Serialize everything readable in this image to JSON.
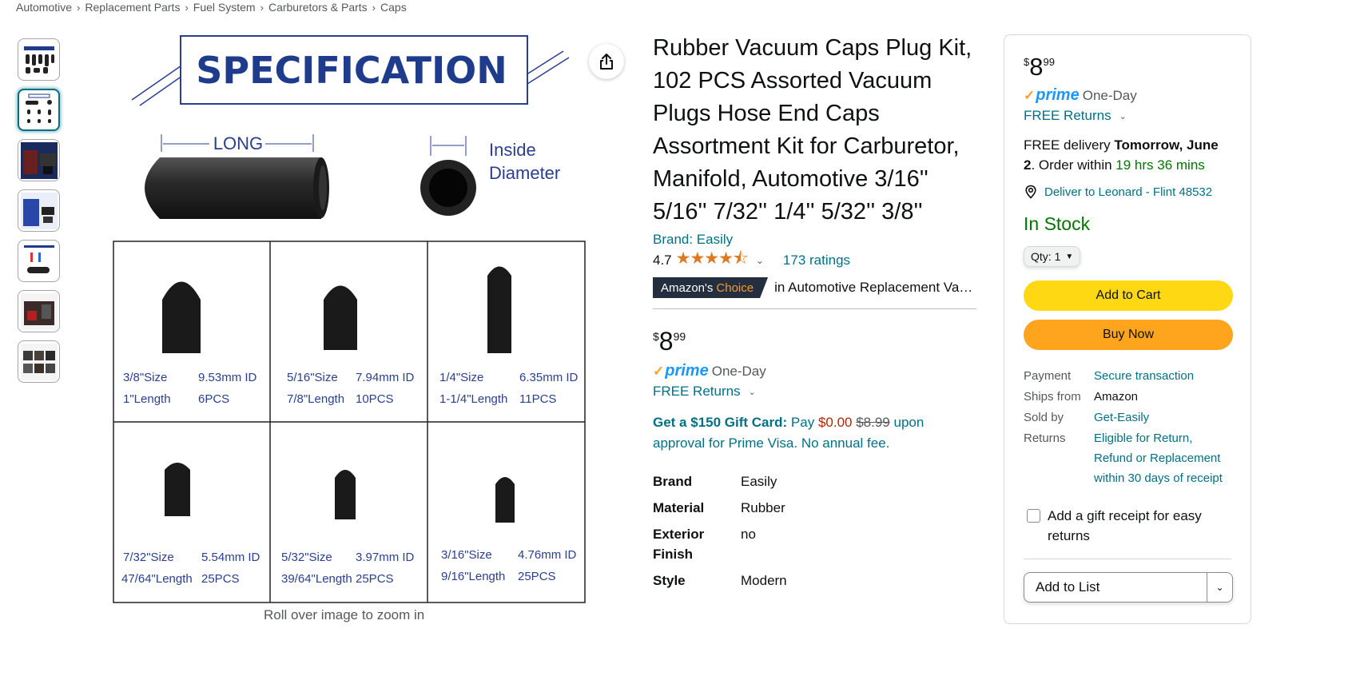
{
  "breadcrumb": [
    "Automotive",
    "Replacement Parts",
    "Fuel System",
    "Carburetors & Parts",
    "Caps"
  ],
  "breadcrumb_sep": "›",
  "image": {
    "spec_title": "SPECIFICATION",
    "long_label": "LONG",
    "inside_label_1": "Inside",
    "inside_label_2": "Diameter",
    "cells": [
      {
        "size": "3/8\"Size",
        "id": "9.53mm ID",
        "length": "1\"Length",
        "pcs": "6PCS"
      },
      {
        "size": "5/16\"Size",
        "id": "7.94mm ID",
        "length": "7/8\"Length",
        "pcs": "10PCS"
      },
      {
        "size": "1/4\"Size",
        "id": "6.35mm ID",
        "length": "1-1/4\"Length",
        "pcs": "11PCS"
      },
      {
        "size": "7/32\"Size",
        "id": "5.54mm ID",
        "length": "47/64\"Length",
        "pcs": "25PCS"
      },
      {
        "size": "5/32\"Size",
        "id": "3.97mm ID",
        "length": "39/64\"Length",
        "pcs": "25PCS"
      },
      {
        "size": "3/16\"Size",
        "id": "4.76mm ID",
        "length": "9/16\"Length",
        "pcs": "25PCS"
      }
    ],
    "zoom_hint": "Roll over image to zoom in"
  },
  "product": {
    "title": "Rubber Vacuum Caps Plug Kit, 102 PCS Assorted Vacuum Plugs Hose End Caps Assortment Kit for Carburetor, Manifold, Automotive 3/16'' 5/16'' 7/32'' 1/4'' 5/32'' 3/8''",
    "brand_link": "Brand: Easily",
    "rating": "4.7",
    "stars": "★★★★⯪",
    "ratings_count": "173 ratings",
    "choice_1": "Amazon's",
    "choice_2": "Choice",
    "choice_category": "in Automotive Replacement Vacuum Hose Caps",
    "price_symbol": "$",
    "price_whole": "8",
    "price_fraction": "99",
    "prime": "prime",
    "prime_one_day": "One-Day",
    "free_returns": "FREE Returns",
    "gift_bold": "Get a $150 Gift Card:",
    "gift_pay": "Pay",
    "gift_new": "$0.00",
    "gift_old": "$8.99",
    "gift_rest": "upon approval for Prime Visa. No annual fee.",
    "specs": [
      {
        "key": "Brand",
        "val": "Easily"
      },
      {
        "key": "Material",
        "val": "Rubber"
      },
      {
        "key": "Exterior Finish",
        "val": "no"
      },
      {
        "key": "Style",
        "val": "Modern"
      }
    ]
  },
  "buybox": {
    "price_symbol": "$",
    "price_whole": "8",
    "price_fraction": "99",
    "prime": "prime",
    "prime_one_day": "One-Day",
    "free_returns": "FREE Returns",
    "delivery_prefix": "FREE delivery",
    "delivery_date": "Tomorrow, June 2",
    "delivery_mid": ". Order within",
    "delivery_countdown": "19 hrs 36 mins",
    "deliver_to": "Deliver to Leonard - Flint 48532",
    "stock": "In Stock",
    "qty_label": "Qty:",
    "qty_value": "1",
    "add_to_cart": "Add to Cart",
    "buy_now": "Buy Now",
    "info": [
      {
        "key": "Payment",
        "val": "Secure transaction",
        "link": true
      },
      {
        "key": "Ships from",
        "val": "Amazon",
        "link": false
      },
      {
        "key": "Sold by",
        "val": "Get-Easily",
        "link": true
      },
      {
        "key": "Returns",
        "val": "Eligible for Return, Refund or Replacement within 30 days of receipt",
        "link": true
      }
    ],
    "gift_receipt": "Add a gift receipt for easy returns",
    "add_to_list": "Add to List"
  },
  "colors": {
    "link": "#007185",
    "in_stock": "#007600",
    "cart_button": "#ffd814",
    "buy_button": "#ffa41c",
    "price_red": "#b12704",
    "star": "#de7921"
  }
}
